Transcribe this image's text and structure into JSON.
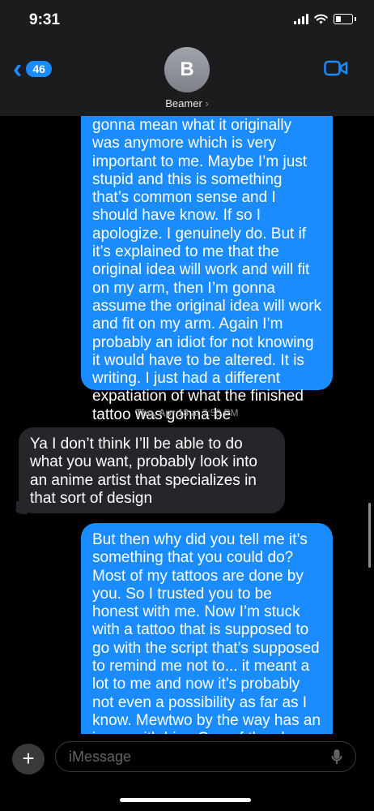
{
  "status": {
    "time": "9:31"
  },
  "nav": {
    "back_count": "46",
    "avatar_initial": "B",
    "contact_name": "Beamer",
    "contact_chevron": "›"
  },
  "messages": [
    {
      "type": "sent",
      "text": "gonna mean what it originally was anymore which is very important to me. Maybe I’m just stupid and this is something that’s common sense and I should have know. If so I apologize. I genuinely do. But if it’s explained to me that the original idea will work and will fit on my arm, then I’m gonna assume the original idea will work and fit on my arm. Again I’m probably an idiot for not knowing it would have to be altered. It is writing. I just had a different expatiation of what the finished tattoo was gonna be"
    },
    {
      "type": "timestamp",
      "day": "Thu, Apr 18",
      "at": "at",
      "time": "7:53 PM"
    },
    {
      "type": "received",
      "text": "Ya I don’t think I’ll be able to do what you want, probably look into an anime artist that specializes in that sort of design"
    },
    {
      "type": "sent",
      "text": "But then why did you tell me it’s something that you could do? Most of my tattoos are done by you. So I trusted you to be honest with me. Now I’m stuck with a tattoo that is supposed to go with the script that’s supposed to remind me not to... it meant a lot to me and now it’s probably not even a possibility as far as I know. Mewtwo by the way has an issue with him. One of the cherry blossom buds is purple"
    }
  ],
  "composer": {
    "placeholder": "iMessage"
  },
  "colors": {
    "sent_bubble": "#1a8cff",
    "received_bubble": "#26252a",
    "background": "#000000"
  }
}
